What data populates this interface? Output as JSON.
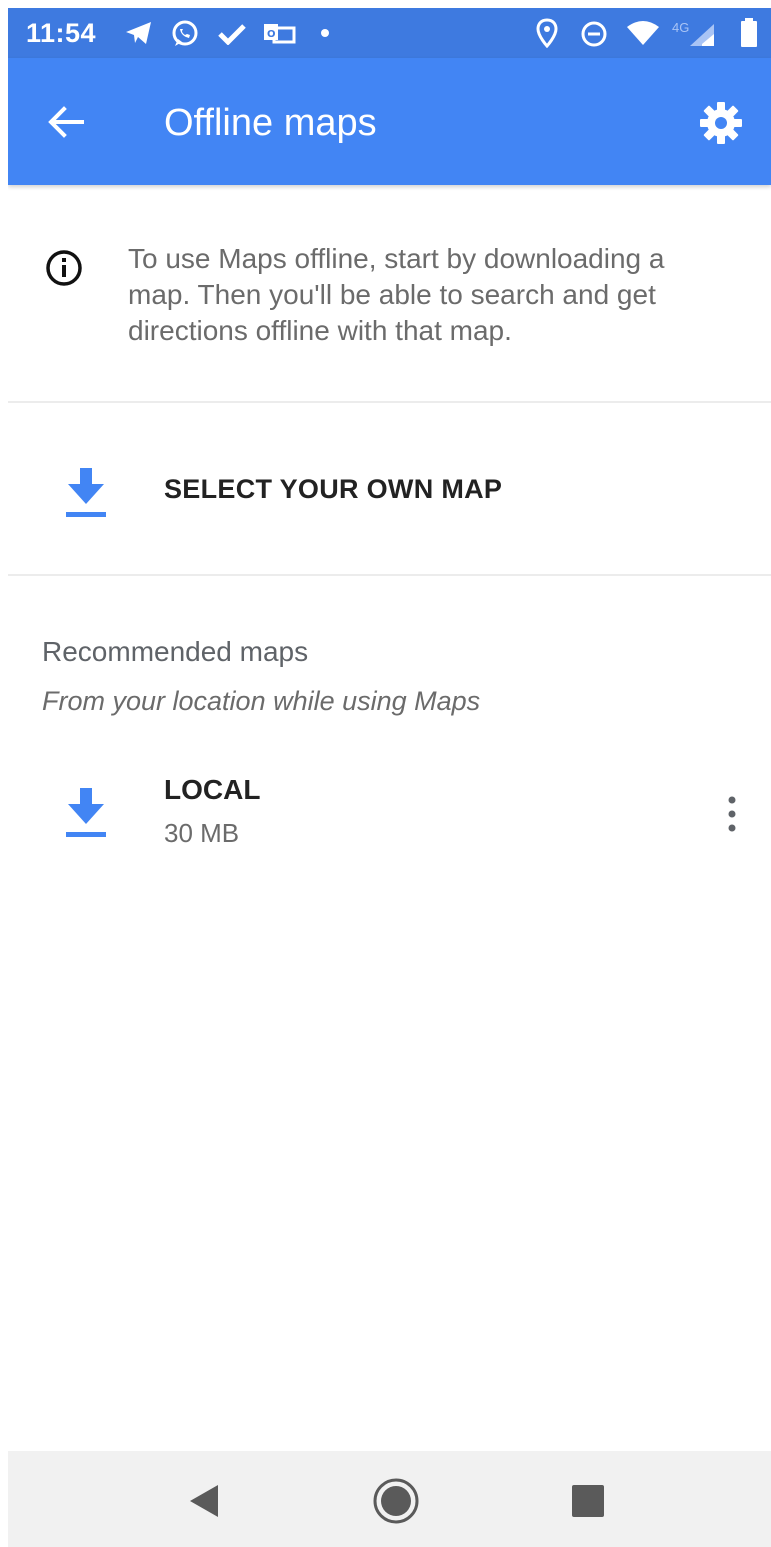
{
  "status_bar": {
    "time": "11:54",
    "network_label": "4G",
    "icons": [
      "telegram-icon",
      "whatsapp-icon",
      "check-icon",
      "outlook-icon",
      "dot-icon",
      "location-icon",
      "do-not-disturb-icon",
      "wifi-icon",
      "signal-icon",
      "battery-icon"
    ]
  },
  "app_bar": {
    "title": "Offline maps",
    "back_icon": "arrow-back-icon",
    "settings_icon": "gear-icon"
  },
  "info": {
    "icon": "info-icon",
    "text": "To use Maps offline, start by downloading a map. Then you'll be able to search and get directions offline with that map."
  },
  "select_map": {
    "icon": "download-icon",
    "label": "SELECT YOUR OWN MAP"
  },
  "recommended": {
    "title": "Recommended maps",
    "subtitle": "From your location while using Maps",
    "items": [
      {
        "name": "LOCAL",
        "size": "30 MB",
        "icon": "download-icon",
        "menu_icon": "more-vert-icon"
      }
    ]
  },
  "nav_bar": {
    "buttons": [
      "nav-back-icon",
      "nav-home-icon",
      "nav-recents-icon"
    ]
  },
  "colors": {
    "app_bar": "#4285f4",
    "status_bar": "#3e7ae0",
    "accent": "#4285f4",
    "nav_bar": "#f1f1f1"
  }
}
